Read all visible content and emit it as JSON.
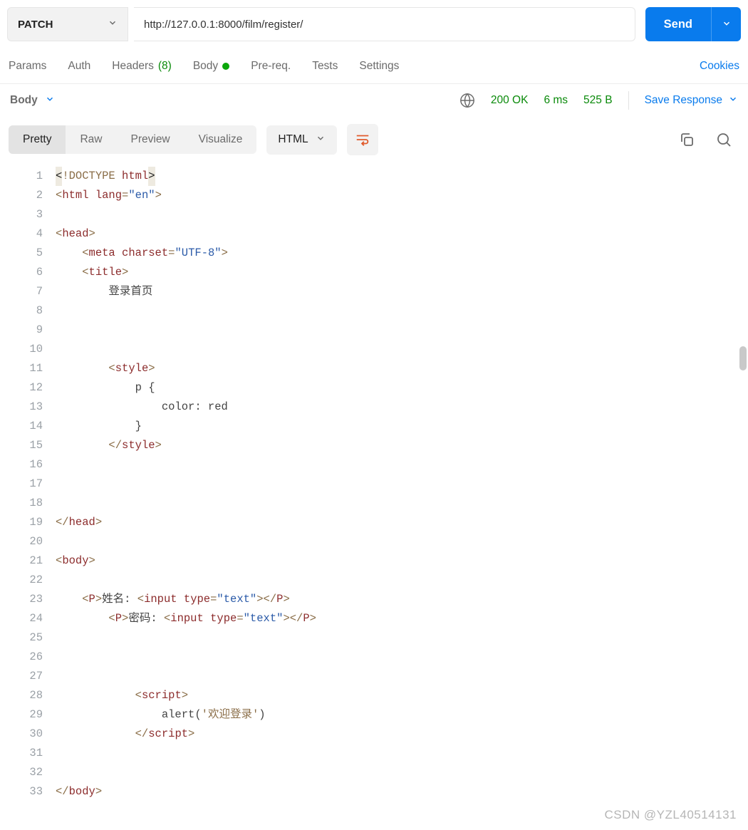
{
  "request": {
    "method": "PATCH",
    "url": "http://127.0.0.1:8000/film/register/",
    "send_label": "Send"
  },
  "tabs": {
    "params": "Params",
    "auth": "Auth",
    "headers": "Headers",
    "headers_count": "(8)",
    "body": "Body",
    "prereq": "Pre-req.",
    "tests": "Tests",
    "settings": "Settings",
    "cookies": "Cookies"
  },
  "status": {
    "body_label": "Body",
    "code": "200 OK",
    "time": "6 ms",
    "size": "525 B",
    "save": "Save Response"
  },
  "toolbar": {
    "pretty": "Pretty",
    "raw": "Raw",
    "preview": "Preview",
    "visualize": "Visualize",
    "lang": "HTML"
  },
  "code": {
    "lines": [
      {
        "n": 1,
        "segs": [
          {
            "t": "hl",
            "v": "<"
          },
          {
            "t": "punct",
            "v": "!DOCTYPE "
          },
          {
            "t": "tag",
            "v": "html"
          },
          {
            "t": "hl",
            "v": ">"
          }
        ]
      },
      {
        "n": 2,
        "segs": [
          {
            "t": "punct",
            "v": "<"
          },
          {
            "t": "tag",
            "v": "html "
          },
          {
            "t": "attr",
            "v": "lang"
          },
          {
            "t": "punct",
            "v": "="
          },
          {
            "t": "str",
            "v": "\"en\""
          },
          {
            "t": "punct",
            "v": ">"
          }
        ]
      },
      {
        "n": 3,
        "segs": []
      },
      {
        "n": 4,
        "segs": [
          {
            "t": "punct",
            "v": "<"
          },
          {
            "t": "tag",
            "v": "head"
          },
          {
            "t": "punct",
            "v": ">"
          }
        ]
      },
      {
        "n": 5,
        "segs": [
          {
            "t": "text",
            "v": "    "
          },
          {
            "t": "punct",
            "v": "<"
          },
          {
            "t": "tag",
            "v": "meta "
          },
          {
            "t": "attr",
            "v": "charset"
          },
          {
            "t": "punct",
            "v": "="
          },
          {
            "t": "str",
            "v": "\"UTF-8\""
          },
          {
            "t": "punct",
            "v": ">"
          }
        ]
      },
      {
        "n": 6,
        "segs": [
          {
            "t": "text",
            "v": "    "
          },
          {
            "t": "punct",
            "v": "<"
          },
          {
            "t": "tag",
            "v": "title"
          },
          {
            "t": "punct",
            "v": ">"
          }
        ]
      },
      {
        "n": 7,
        "segs": [
          {
            "t": "text",
            "v": "        登录首页"
          }
        ]
      },
      {
        "n": 8,
        "segs": []
      },
      {
        "n": 9,
        "segs": []
      },
      {
        "n": 10,
        "segs": []
      },
      {
        "n": 11,
        "segs": [
          {
            "t": "text",
            "v": "        "
          },
          {
            "t": "punct",
            "v": "<"
          },
          {
            "t": "tag",
            "v": "style"
          },
          {
            "t": "punct",
            "v": ">"
          }
        ]
      },
      {
        "n": 12,
        "segs": [
          {
            "t": "css",
            "v": "            p {"
          }
        ]
      },
      {
        "n": 13,
        "segs": [
          {
            "t": "css",
            "v": "                color: red"
          }
        ]
      },
      {
        "n": 14,
        "segs": [
          {
            "t": "css",
            "v": "            }"
          }
        ]
      },
      {
        "n": 15,
        "segs": [
          {
            "t": "text",
            "v": "        "
          },
          {
            "t": "punct",
            "v": "</"
          },
          {
            "t": "tag",
            "v": "style"
          },
          {
            "t": "punct",
            "v": ">"
          }
        ]
      },
      {
        "n": 16,
        "segs": []
      },
      {
        "n": 17,
        "segs": []
      },
      {
        "n": 18,
        "segs": []
      },
      {
        "n": 19,
        "segs": [
          {
            "t": "punct",
            "v": "</"
          },
          {
            "t": "tag",
            "v": "head"
          },
          {
            "t": "punct",
            "v": ">"
          }
        ]
      },
      {
        "n": 20,
        "segs": []
      },
      {
        "n": 21,
        "segs": [
          {
            "t": "punct",
            "v": "<"
          },
          {
            "t": "tag",
            "v": "body"
          },
          {
            "t": "punct",
            "v": ">"
          }
        ]
      },
      {
        "n": 22,
        "segs": []
      },
      {
        "n": 23,
        "segs": [
          {
            "t": "text",
            "v": "    "
          },
          {
            "t": "punct",
            "v": "<"
          },
          {
            "t": "tag",
            "v": "P"
          },
          {
            "t": "punct",
            "v": ">"
          },
          {
            "t": "text",
            "v": "姓名: "
          },
          {
            "t": "punct",
            "v": "<"
          },
          {
            "t": "tag",
            "v": "input "
          },
          {
            "t": "attr",
            "v": "type"
          },
          {
            "t": "punct",
            "v": "="
          },
          {
            "t": "str",
            "v": "\"text\""
          },
          {
            "t": "punct",
            "v": "></"
          },
          {
            "t": "tag",
            "v": "P"
          },
          {
            "t": "punct",
            "v": ">"
          }
        ]
      },
      {
        "n": 24,
        "segs": [
          {
            "t": "text",
            "v": "        "
          },
          {
            "t": "punct",
            "v": "<"
          },
          {
            "t": "tag",
            "v": "P"
          },
          {
            "t": "punct",
            "v": ">"
          },
          {
            "t": "text",
            "v": "密码: "
          },
          {
            "t": "punct",
            "v": "<"
          },
          {
            "t": "tag",
            "v": "input "
          },
          {
            "t": "attr",
            "v": "type"
          },
          {
            "t": "punct",
            "v": "="
          },
          {
            "t": "str",
            "v": "\"text\""
          },
          {
            "t": "punct",
            "v": "></"
          },
          {
            "t": "tag",
            "v": "P"
          },
          {
            "t": "punct",
            "v": ">"
          }
        ]
      },
      {
        "n": 25,
        "segs": []
      },
      {
        "n": 26,
        "segs": []
      },
      {
        "n": 27,
        "segs": []
      },
      {
        "n": 28,
        "segs": [
          {
            "t": "text",
            "v": "            "
          },
          {
            "t": "punct",
            "v": "<"
          },
          {
            "t": "tag",
            "v": "script"
          },
          {
            "t": "punct",
            "v": ">"
          }
        ]
      },
      {
        "n": 29,
        "segs": [
          {
            "t": "alert",
            "v": "                alert("
          },
          {
            "t": "quote",
            "v": "'欢迎登录'"
          },
          {
            "t": "alert",
            "v": ")"
          }
        ]
      },
      {
        "n": 30,
        "segs": [
          {
            "t": "text",
            "v": "            "
          },
          {
            "t": "punct",
            "v": "</"
          },
          {
            "t": "tag",
            "v": "script"
          },
          {
            "t": "punct",
            "v": ">"
          }
        ]
      },
      {
        "n": 31,
        "segs": []
      },
      {
        "n": 32,
        "segs": []
      },
      {
        "n": 33,
        "segs": [
          {
            "t": "punct",
            "v": "</"
          },
          {
            "t": "tag",
            "v": "body"
          },
          {
            "t": "punct",
            "v": ">"
          }
        ]
      }
    ]
  },
  "watermark": "CSDN @YZL40514131"
}
